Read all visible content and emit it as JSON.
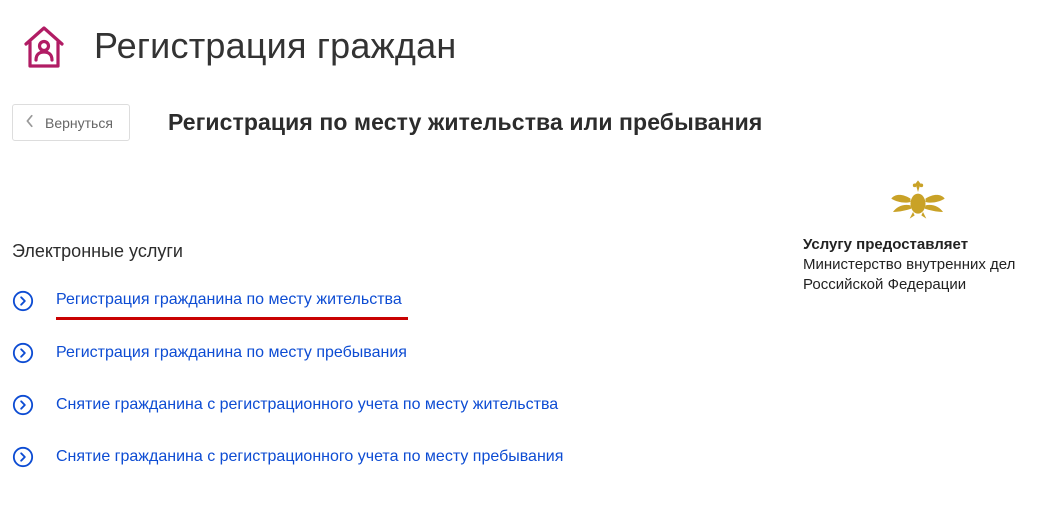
{
  "header": {
    "title": "Регистрация граждан"
  },
  "back": {
    "label": "Вернуться"
  },
  "subtitle": "Регистрация по месту жительства или пребывания",
  "provider": {
    "label": "Услугу предоставляет",
    "name": "Министерство внутренних дел Российской Федерации"
  },
  "sectionTitle": "Электронные услуги",
  "services": [
    {
      "label": "Регистрация гражданина по месту жительства",
      "highlighted": true
    },
    {
      "label": "Регистрация гражданина по месту пребывания",
      "highlighted": false
    },
    {
      "label": "Снятие гражданина с регистрационного учета по месту жительства",
      "highlighted": false
    },
    {
      "label": "Снятие гражданина с регистрационного учета по месту пребывания",
      "highlighted": false
    }
  ]
}
